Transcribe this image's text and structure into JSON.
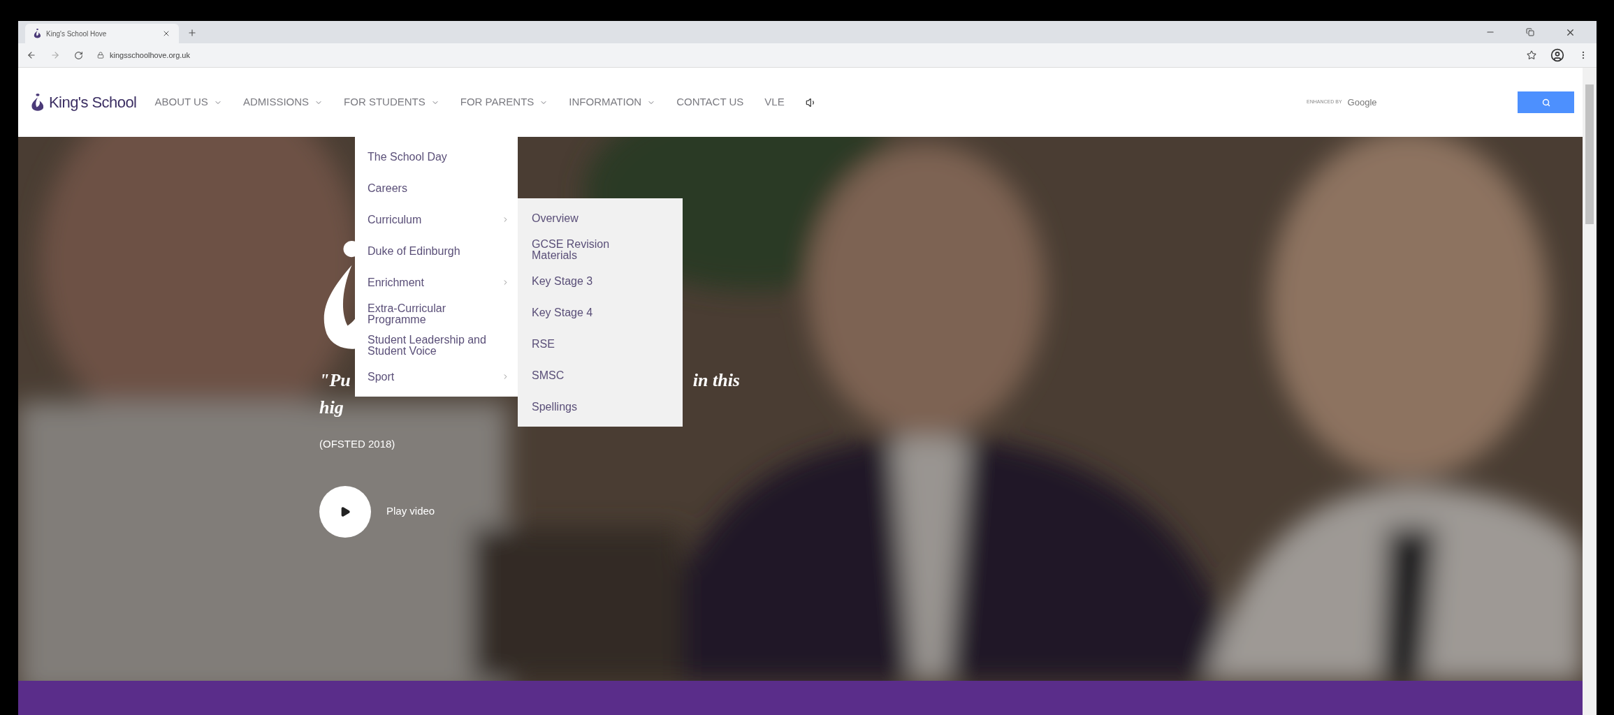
{
  "browser": {
    "tab_title": "King's School Hove",
    "url": "kingsschoolhove.org.uk"
  },
  "site_nav": {
    "brand": "King's School",
    "items": [
      {
        "label": "ABOUT US",
        "has_menu": true
      },
      {
        "label": "ADMISSIONS",
        "has_menu": true
      },
      {
        "label": "FOR STUDENTS",
        "has_menu": true,
        "menu": [
          {
            "label": "The School Day",
            "has_submenu": false
          },
          {
            "label": "Careers",
            "has_submenu": false
          },
          {
            "label": "Curriculum",
            "has_submenu": true,
            "submenu": [
              "Overview",
              "GCSE Revision Materials",
              "Key Stage 3",
              "Key Stage 4",
              "RSE",
              "SMSC",
              "Spellings"
            ]
          },
          {
            "label": "Duke of Edinburgh",
            "has_submenu": false
          },
          {
            "label": "Enrichment",
            "has_submenu": true
          },
          {
            "label": "Extra-Curricular Programme",
            "has_submenu": false
          },
          {
            "label": "Student Leadership and Student Voice",
            "has_submenu": false
          },
          {
            "label": "Sport",
            "has_submenu": true
          }
        ]
      },
      {
        "label": "FOR PARENTS",
        "has_menu": true
      },
      {
        "label": "INFORMATION",
        "has_menu": true
      },
      {
        "label": "CONTACT US",
        "has_menu": false
      },
      {
        "label": "VLE",
        "has_menu": false
      }
    ],
    "search": {
      "branding_prefix": "ENHANCED BY",
      "branding_name": "Google"
    }
  },
  "hero": {
    "quote_line_1_start": "\"Pu",
    "quote_line_1_end": "in this",
    "quote_line_2": "hig",
    "source": "(OFSTED 2018)",
    "play_label": "Play video"
  }
}
